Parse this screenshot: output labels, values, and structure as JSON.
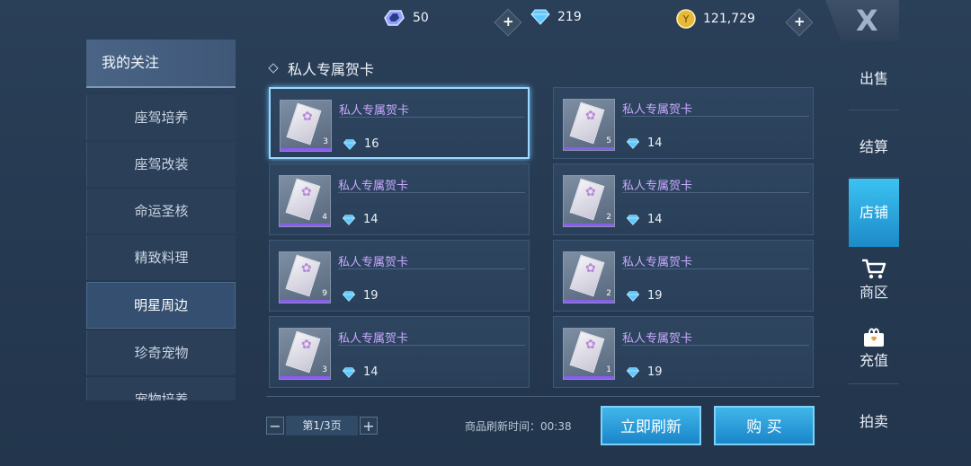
{
  "currencies": [
    {
      "icon": "crystal-icon",
      "value": "50"
    },
    {
      "icon": "diamond-icon",
      "value": "219"
    },
    {
      "icon": "gold-coin-icon",
      "value": "121,729"
    }
  ],
  "close_label": "X",
  "categories": {
    "header": "我的关注",
    "items": [
      "座驾培养",
      "座驾改装",
      "命运圣核",
      "精致料理",
      "明星周边",
      "珍奇宠物",
      "宠物培养"
    ],
    "active_index": 4
  },
  "panel": {
    "title": "私人专属贺卡"
  },
  "cards": [
    {
      "name": "私人专属贺卡",
      "qty": "3",
      "price": "16",
      "selected": true
    },
    {
      "name": "私人专属贺卡",
      "qty": "5",
      "price": "14",
      "selected": false
    },
    {
      "name": "私人专属贺卡",
      "qty": "4",
      "price": "14",
      "selected": false
    },
    {
      "name": "私人专属贺卡",
      "qty": "2",
      "price": "14",
      "selected": false
    },
    {
      "name": "私人专属贺卡",
      "qty": "9",
      "price": "19",
      "selected": false
    },
    {
      "name": "私人专属贺卡",
      "qty": "2",
      "price": "19",
      "selected": false
    },
    {
      "name": "私人专属贺卡",
      "qty": "3",
      "price": "14",
      "selected": false
    },
    {
      "name": "私人专属贺卡",
      "qty": "1",
      "price": "19",
      "selected": false
    }
  ],
  "pager": {
    "label": "第1/3页",
    "minus": "−",
    "plus": "+"
  },
  "refresh": {
    "label": "商品刷新时间：",
    "time": "00:38"
  },
  "buttons": {
    "refresh": "立即刷新",
    "buy": "购 买"
  },
  "nav": {
    "sell": "出售",
    "checkout": "结算",
    "shop": "店铺",
    "mall": "商区",
    "recharge": "充值",
    "auction": "拍卖"
  },
  "colors": {
    "accent": "#2ea7e0",
    "card_name": "#c9a8ff",
    "selected_border": "#9cd8ff"
  }
}
